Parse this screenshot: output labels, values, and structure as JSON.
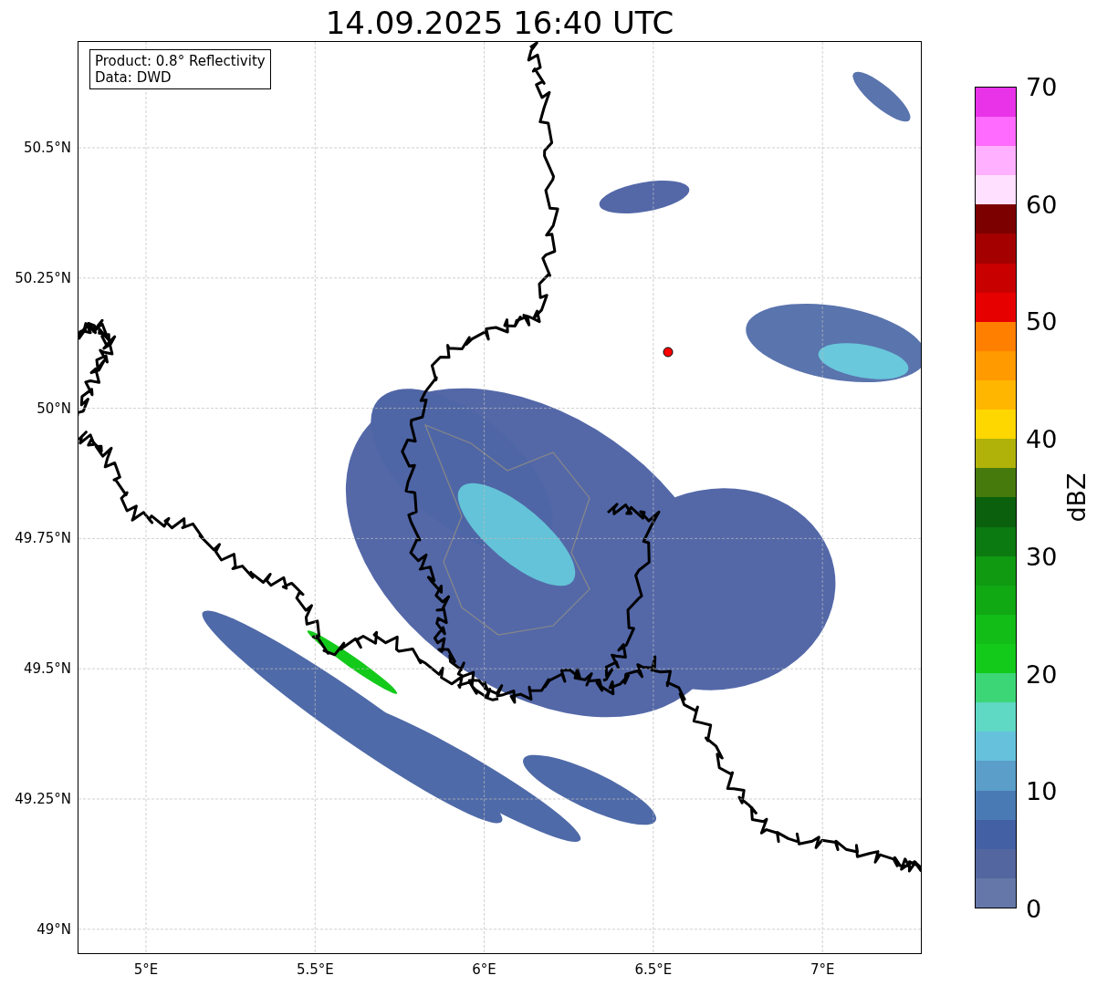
{
  "title": "14.09.2025 16:40 UTC",
  "annotation": [
    "Product: 0.8° Reflectivity",
    "Data: DWD"
  ],
  "map": {
    "x_ticks": [
      "5°E",
      "5.5°E",
      "6°E",
      "6.5°E",
      "7°E"
    ],
    "y_ticks": [
      "50.5°N",
      "50.25°N",
      "50°N",
      "49.75°N",
      "49.5°N",
      "49.25°N",
      "49°N"
    ]
  },
  "colorbar": {
    "label": "dBZ",
    "ticks": [
      "70",
      "60",
      "50",
      "40",
      "30",
      "20",
      "10",
      "0"
    ],
    "bins": [
      {
        "color": "#6477a8"
      },
      {
        "color": "#5366a0"
      },
      {
        "color": "#4460a5"
      },
      {
        "color": "#4a7ab3"
      },
      {
        "color": "#5a9ec9"
      },
      {
        "color": "#66c2dc"
      },
      {
        "color": "#5fd8c4"
      },
      {
        "color": "#3cd677"
      },
      {
        "color": "#13c91a"
      },
      {
        "color": "#12bd17"
      },
      {
        "color": "#10a813"
      },
      {
        "color": "#109a12"
      },
      {
        "color": "#0b7a10"
      },
      {
        "color": "#0a600d"
      },
      {
        "color": "#467a0c"
      },
      {
        "color": "#b0b20a"
      },
      {
        "color": "#ffd700"
      },
      {
        "color": "#ffb600"
      },
      {
        "color": "#ff9a00"
      },
      {
        "color": "#ff7f00"
      },
      {
        "color": "#e60000"
      },
      {
        "color": "#c80000"
      },
      {
        "color": "#a50000"
      },
      {
        "color": "#7d0000"
      },
      {
        "color": "#ffe0ff"
      },
      {
        "color": "#ffb0ff"
      },
      {
        "color": "#ff6bff"
      },
      {
        "color": "#e833e8"
      }
    ]
  }
}
